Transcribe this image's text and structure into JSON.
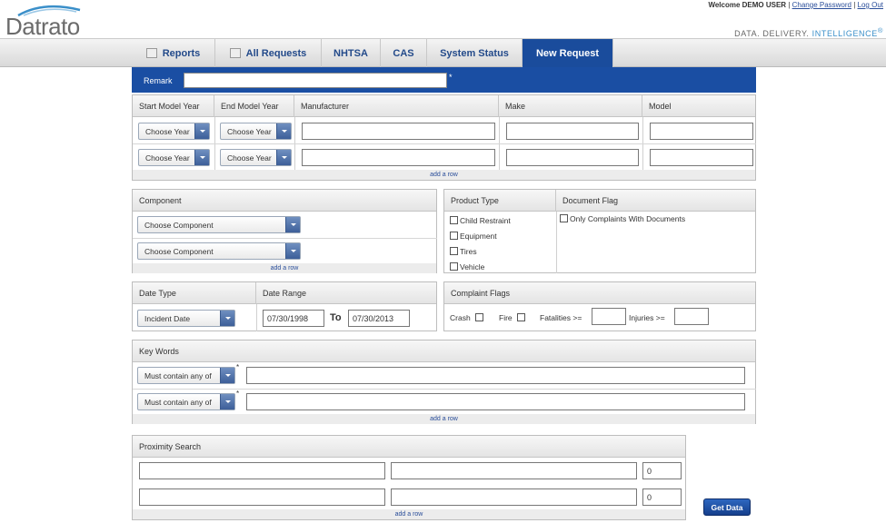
{
  "header": {
    "logo_text": "Datrato",
    "welcome": "Welcome DEMO USER",
    "change_password": "Change Password",
    "logout": "Log Out",
    "tagline_a": "DATA. DELIVERY.",
    "tagline_b": "INTELLIGENCE",
    "tagline_reg": "®",
    "brand_color": "#1a4c9c"
  },
  "nav": {
    "tabs": [
      {
        "label": "Reports",
        "icon": "chart-icon"
      },
      {
        "label": "All Requests",
        "icon": "document-icon"
      },
      {
        "label": "NHTSA"
      },
      {
        "label": "CAS"
      },
      {
        "label": "System Status"
      },
      {
        "label": "New Request",
        "active": true
      }
    ]
  },
  "remark": {
    "label": "Remark",
    "value": "",
    "required_mark": "*"
  },
  "vehicle": {
    "headers": [
      "Start Model Year",
      "End Model Year",
      "Manufacturer",
      "Make",
      "Model"
    ],
    "rows": [
      {
        "start_year": "Choose Year",
        "end_year": "Choose Year"
      },
      {
        "start_year": "Choose Year",
        "end_year": "Choose Year"
      }
    ],
    "add_row": "add a row"
  },
  "component": {
    "title": "Component",
    "rows": [
      "Choose Component",
      "Choose Component"
    ],
    "add_row": "add a row"
  },
  "product_type": {
    "title": "Product Type",
    "options": [
      "Child Restraint",
      "Equipment",
      "Tires",
      "Vehicle"
    ]
  },
  "document_flag": {
    "title": "Document Flag",
    "option": "Only Complaints With Documents"
  },
  "date": {
    "type_title": "Date Type",
    "range_title": "Date Range",
    "type_value": "Incident Date",
    "from": "07/30/1998",
    "to_label": "To",
    "to": "07/30/2013"
  },
  "complaint_flags": {
    "title": "Complaint Flags",
    "crash": "Crash",
    "fire": "Fire",
    "fatalities": "Fatalities >=",
    "injuries": "Injuries >="
  },
  "keywords": {
    "title": "Key Words",
    "rows": [
      "Must contain any of",
      "Must contain any of"
    ],
    "required_mark": "*",
    "add_row": "add a row"
  },
  "proximity": {
    "title": "Proximity Search",
    "rows": [
      {
        "distance": "0"
      },
      {
        "distance": "0"
      }
    ],
    "add_row": "add a row"
  },
  "get_data_label": "Get Data"
}
